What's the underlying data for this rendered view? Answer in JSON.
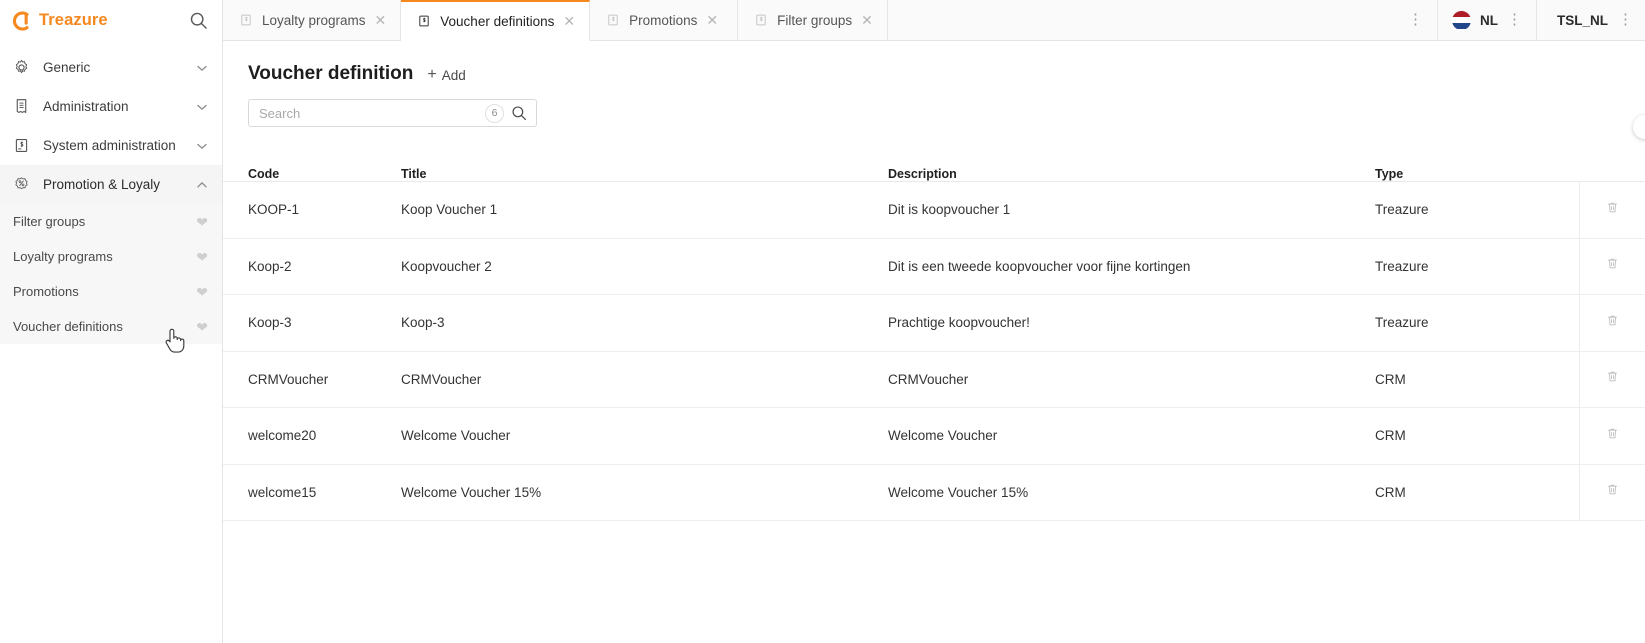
{
  "brand": {
    "name": "Treazure",
    "logo_color": "#f5881f",
    "search_icon": "search-icon"
  },
  "sidebar": {
    "groups": [
      {
        "label": "Generic",
        "icon": "gear-icon",
        "chevron": "chevron-down-icon",
        "active": false
      },
      {
        "label": "Administration",
        "icon": "document-icon",
        "chevron": "chevron-down-icon",
        "active": false
      },
      {
        "label": "System administration",
        "icon": "document-settings-icon",
        "chevron": "chevron-down-icon",
        "active": false
      },
      {
        "label": "Promotion & Loyaly",
        "icon": "percent-badge-icon",
        "chevron": "chevron-up-icon",
        "active": true
      }
    ],
    "subitems": [
      {
        "label": "Filter groups",
        "favorite_icon": "heart-icon"
      },
      {
        "label": "Loyalty programs",
        "favorite_icon": "heart-icon"
      },
      {
        "label": "Promotions",
        "favorite_icon": "heart-icon"
      },
      {
        "label": "Voucher definitions",
        "favorite_icon": "heart-icon"
      }
    ]
  },
  "tabs": [
    {
      "label": "Loyalty programs",
      "icon": "page-icon",
      "close_icon": "close-icon",
      "active": false
    },
    {
      "label": "Voucher definitions",
      "icon": "page-icon",
      "close_icon": "close-icon",
      "active": true
    },
    {
      "label": "Promotions",
      "icon": "page-icon",
      "close_icon": "close-icon",
      "active": false
    },
    {
      "label": "Filter groups",
      "icon": "page-icon",
      "close_icon": "close-icon",
      "active": false
    }
  ],
  "topbar": {
    "overflow_icon": "more-vertical-icon",
    "locale": {
      "label": "NL",
      "flag": "netherlands-flag-icon",
      "menu_icon": "more-vertical-icon",
      "flag_colors": [
        "#ae1c28",
        "#ffffff",
        "#21468b"
      ]
    },
    "tenant": {
      "label": "TSL_NL",
      "menu_icon": "more-vertical-icon"
    }
  },
  "page": {
    "title": "Voucher definition",
    "add": {
      "label": "Add",
      "plus": "+"
    }
  },
  "search": {
    "placeholder": "Search",
    "value": "",
    "count": "6",
    "icon": "search-icon"
  },
  "table": {
    "columns": [
      "Code",
      "Title",
      "Description",
      "Type"
    ],
    "row_action_icon": "trash-icon",
    "rows": [
      {
        "code": "KOOP-1",
        "title": "Koop Voucher 1",
        "description": "Dit is koopvoucher 1",
        "type": "Treazure"
      },
      {
        "code": "Koop-2",
        "title": "Koopvoucher 2",
        "description": "Dit is een tweede koopvoucher voor fijne kortingen",
        "type": "Treazure"
      },
      {
        "code": "Koop-3",
        "title": "Koop-3",
        "description": "Prachtige koopvoucher!",
        "type": "Treazure"
      },
      {
        "code": "CRMVoucher",
        "title": "CRMVoucher",
        "description": "CRMVoucher",
        "type": "CRM"
      },
      {
        "code": "welcome20",
        "title": "Welcome Voucher",
        "description": "Welcome Voucher",
        "type": "CRM"
      },
      {
        "code": "welcome15",
        "title": "Welcome Voucher 15%",
        "description": "Welcome Voucher 15%",
        "type": "CRM"
      }
    ]
  }
}
